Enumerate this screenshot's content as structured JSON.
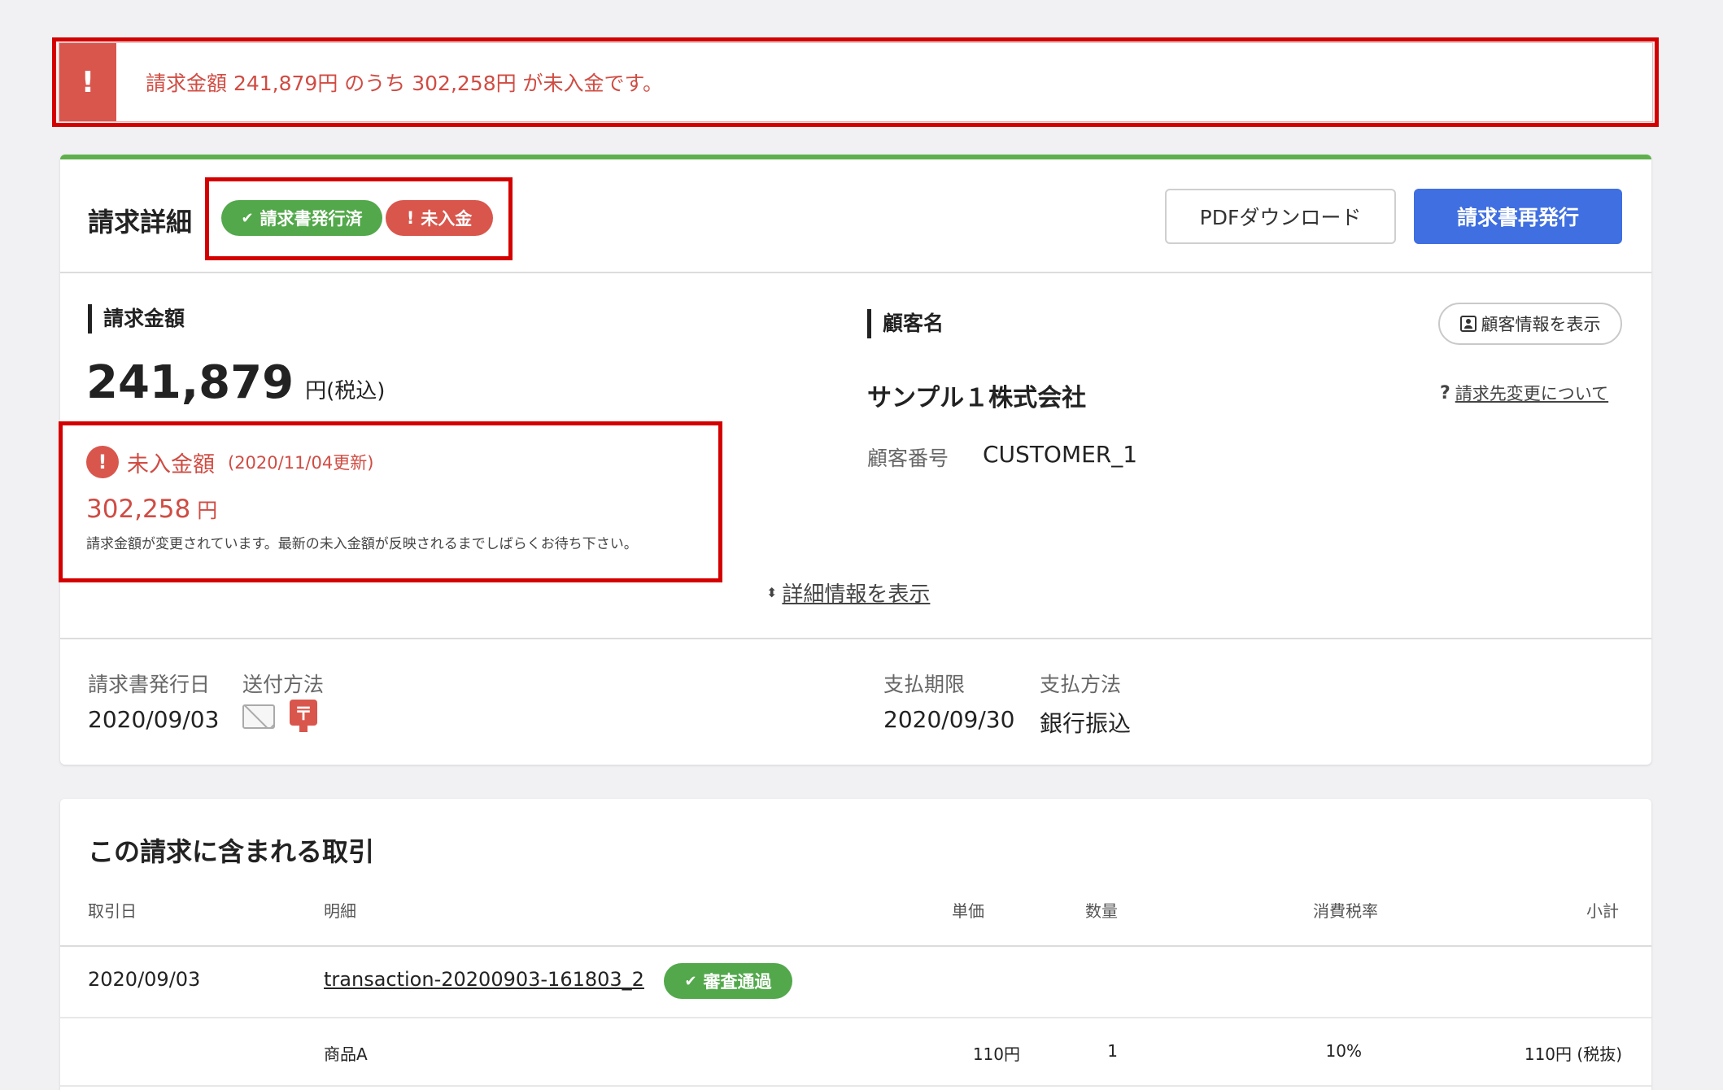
{
  "alert": {
    "icon": "!",
    "message": "請求金額 241,879円 のうち 302,258円 が未入金です。"
  },
  "header": {
    "title": "請求詳細",
    "badges": [
      {
        "icon": "✔",
        "label": "請求書発行済",
        "color": "#52a84a"
      },
      {
        "icon": "!",
        "label": "未入金",
        "color": "#d9564d"
      }
    ],
    "pdf_button": "PDFダウンロード",
    "reissue_button": "請求書再発行"
  },
  "billing": {
    "label": "請求金額",
    "amount": "241,879",
    "unit": "円(税込)",
    "unpaid": {
      "icon": "!",
      "label": "未入金額",
      "updated": "(2020/11/04更新)",
      "amount": "302,258",
      "unit": "円",
      "note": "請求金額が変更されています。最新の未入金額が反映されるまでしばらくお待ち下さい。"
    }
  },
  "customer": {
    "label": "顧客名",
    "show_info_button": "顧客情報を表示",
    "name": "サンプル１株式会社",
    "change_link_icon": "?",
    "change_link": "請求先変更について",
    "number_label": "顧客番号",
    "number_value": "CUSTOMER_1"
  },
  "details_toggle": "詳細情報を表示",
  "issue": {
    "issue_date_label": "請求書発行日",
    "issue_date": "2020/09/03",
    "delivery_label": "送付方法",
    "due_label": "支払期限",
    "due_date": "2020/09/30",
    "payment_label": "支払方法",
    "payment_method": "銀行振込"
  },
  "transactions": {
    "title": "この請求に含まれる取引",
    "columns": [
      "取引日",
      "明細",
      "単価",
      "数量",
      "消費税率",
      "小計"
    ],
    "row": {
      "date": "2020/09/03",
      "id": "transaction-20200903-161803_2",
      "status": "審査通過",
      "status_icon": "✔"
    },
    "item": {
      "name": "商品A",
      "unit_price": "110円",
      "quantity": "1",
      "tax_rate": "10%",
      "subtotal": "110円 (税抜)"
    }
  }
}
